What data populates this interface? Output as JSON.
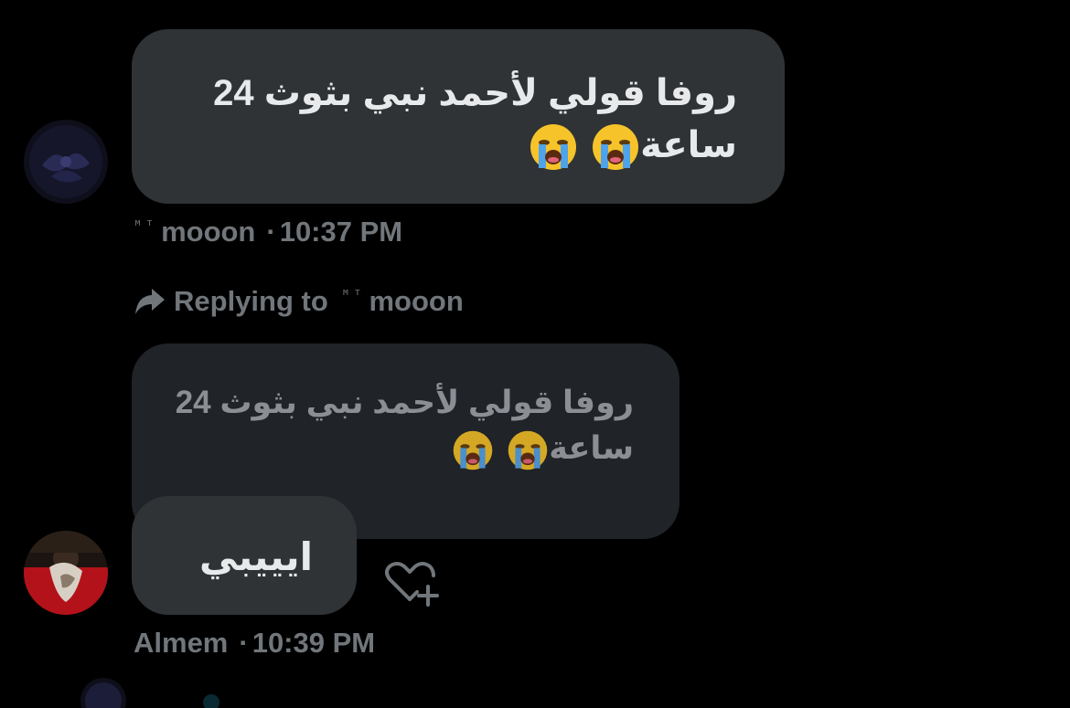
{
  "messages": [
    {
      "sender": "ᴹᵀmooon",
      "sender_badge": "ᴹᵀ",
      "sender_name": "mooon",
      "text_line1": "روفا قولي لأحمد نبي بثوث 24",
      "text_line2": "ساعة",
      "emoji_icon": "loudly-crying-face-icon",
      "emoji_count": 2,
      "time": "10:37 PM"
    },
    {
      "sender_name": "Almem",
      "replying_label": "Replying to",
      "replying_badge": "ᴹᵀ",
      "replying_name": "mooon",
      "quoted_line1": "روفا قولي لأحمد نبي بثوث 24",
      "quoted_line2": "ساعة",
      "text": "ايييبي",
      "time": "10:39 PM",
      "reaction_icon": "heart-plus-icon"
    }
  ],
  "separator": "·",
  "colors": {
    "background": "#000000",
    "bubble": "#2f3336",
    "quoted_bubble": "#202327",
    "text": "#e7e9ea",
    "muted": "#71767b"
  }
}
